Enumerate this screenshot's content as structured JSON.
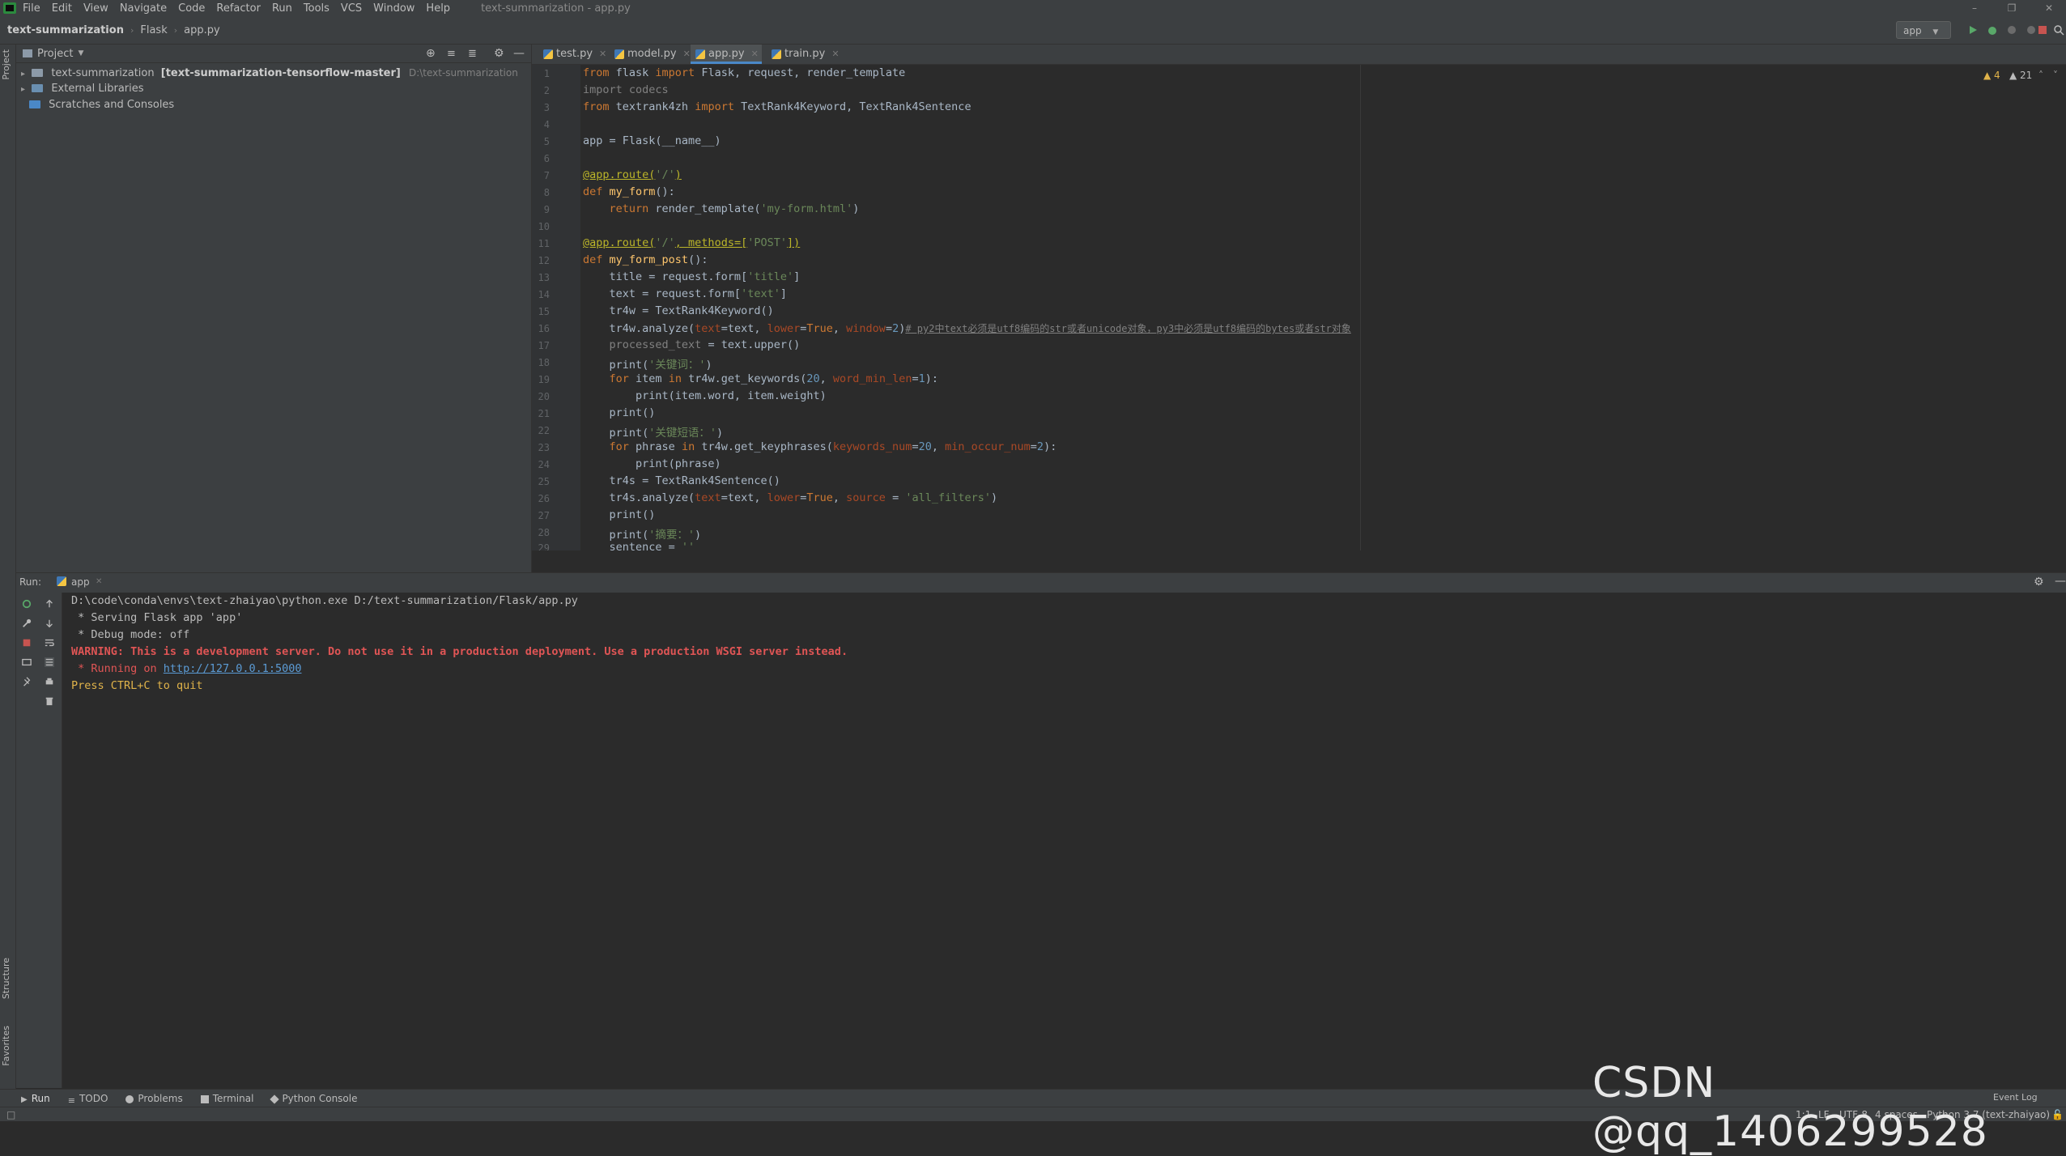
{
  "colors": {
    "accent": "#4a88c7",
    "keyword": "#cc7832",
    "string": "#6a8759",
    "decorator": "#bbb529",
    "error": "#e05555",
    "link": "#5b9bd5"
  },
  "window": {
    "title": "text-summarization - app.py"
  },
  "menu": [
    "File",
    "Edit",
    "View",
    "Navigate",
    "Code",
    "Refactor",
    "Run",
    "Tools",
    "VCS",
    "Window",
    "Help"
  ],
  "breadcrumb": {
    "project": "text-summarization",
    "folder": "Flask",
    "file": "app.py"
  },
  "run_config": "app",
  "left_stripe": {
    "project": "Project",
    "structure": "Structure",
    "favorites": "Favorites"
  },
  "project_panel": {
    "title": "Project",
    "tree": [
      {
        "name": "text-summarization",
        "bold": "[text-summarization-tensorflow-master]",
        "path": "D:\\text-summarization"
      },
      {
        "name": "External Libraries"
      },
      {
        "name": "Scratches and Consoles"
      }
    ]
  },
  "tabs": [
    {
      "label": "test.py"
    },
    {
      "label": "model.py"
    },
    {
      "label": "app.py"
    },
    {
      "label": "train.py"
    }
  ],
  "inspections": {
    "warnings": "4",
    "weak": "21"
  },
  "code": {
    "line_numbers": [
      "1",
      "2",
      "3",
      "4",
      "5",
      "6",
      "7",
      "8",
      "9",
      "10",
      "11",
      "12",
      "13",
      "14",
      "15",
      "16",
      "17",
      "18",
      "19",
      "20",
      "21",
      "22",
      "23",
      "24",
      "25",
      "26",
      "27",
      "28",
      "29"
    ],
    "l1": {
      "a": "from",
      "b": " flask ",
      "c": "import",
      "d": " Flask, request, render_template"
    },
    "l2": "import codecs",
    "l3": {
      "a": "from",
      "b": " textrank4zh ",
      "c": "import",
      "d": " TextRank4Keyword, TextRank4Sentence"
    },
    "l5": "app = Flask(__name__)",
    "l7": {
      "deco": "@app.route(",
      "s": "'/'",
      "end": ")"
    },
    "l8": {
      "kw": "def",
      "fn": " my_form",
      "end": "():"
    },
    "l9": {
      "kw": "    return",
      "a": " render_template(",
      "s": "'my-form.html'",
      "end": ")"
    },
    "l11": {
      "deco": "@app.route(",
      "s": "'/'",
      "m": ", methods=[",
      "s2": "'POST'",
      "end": "])"
    },
    "l12": {
      "kw": "def",
      "fn": " my_form_post",
      "end": "():"
    },
    "l13": {
      "a": "    title = request.form[",
      "s": "'title'",
      "end": "]"
    },
    "l14": {
      "a": "    text = request.form[",
      "s": "'text'",
      "end": "]"
    },
    "l15": "    tr4w = TextRank4Keyword()",
    "l16": {
      "a": "    tr4w.analyze(",
      "p1": "text",
      "b": "=text, ",
      "p2": "lower",
      "c": "=",
      "kw": "True",
      "d": ", ",
      "p3": "window",
      "e": "=",
      "n": "2",
      "f": ")",
      "cmt": "# py2中text必须是utf8编码的str或者unicode对象，py3中必须是utf8编码的bytes或者str对象"
    },
    "l17": {
      "g": "    processed_text",
      "a": " = text.upper()"
    },
    "l18": {
      "a": "    print(",
      "s": "'关键词：'",
      "end": ")"
    },
    "l19": {
      "kw": "    for",
      "a": " item ",
      "kw2": "in",
      "b": " tr4w.get_keywords(",
      "n": "20",
      "c": ", ",
      "p": "word_min_len",
      "d": "=",
      "n2": "1",
      "end": "):"
    },
    "l20": "        print(item.word, item.weight)",
    "l21": "    print()",
    "l22": {
      "a": "    print(",
      "s": "'关键短语：'",
      "end": ")"
    },
    "l23": {
      "kw": "    for",
      "a": " phrase ",
      "kw2": "in",
      "b": " tr4w.get_keyphrases(",
      "p": "keywords_num",
      "c": "=",
      "n": "20",
      "d": ", ",
      "p2": "min_occur_num",
      "e": "=",
      "n2": "2",
      "end": "):"
    },
    "l24": "        print(phrase)",
    "l25": "    tr4s = TextRank4Sentence()",
    "l26": {
      "a": "    tr4s.analyze(",
      "p1": "text",
      "b": "=text, ",
      "p2": "lower",
      "c": "=",
      "kw": "True",
      "d": ", ",
      "p3": "source",
      "e": " = ",
      "s": "'all_filters'",
      "end": ")"
    },
    "l27": "    print()",
    "l28": {
      "a": "    print(",
      "s": "'摘要：'",
      "end": ")"
    },
    "l29": {
      "a": "    sentence = ",
      "s": "''",
      "end": ""
    }
  },
  "run_panel": {
    "label": "Run:",
    "tab": "app",
    "console": {
      "cmd": "D:\\code\\conda\\envs\\text-zhaiyao\\python.exe D:/text-summarization/Flask/app.py",
      "serving": " * Serving Flask app 'app'",
      "debug": " * Debug mode: off",
      "warning": "WARNING: This is a development server. Do not use it in a production deployment. Use a production WSGI server instead.",
      "running_prefix": " * Running on ",
      "url": "http://127.0.0.1:5000",
      "quit": "Press CTRL+C to quit"
    }
  },
  "bottom_tabs": [
    "Run",
    "TODO",
    "Problems",
    "Terminal",
    "Python Console"
  ],
  "status": {
    "position": "1:1",
    "line_sep": "LF",
    "encoding": "UTF-8",
    "indent": "4 spaces",
    "interpreter": "Python 3.7 (text-zhaiyao)",
    "event_log": "Event Log"
  },
  "watermark": "CSDN @qq_1406299528"
}
